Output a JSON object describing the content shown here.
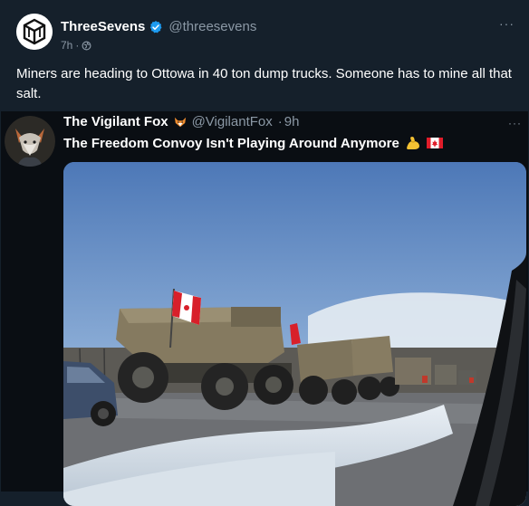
{
  "tweet": {
    "display_name": "ThreeSevens",
    "handle": "@threesevens",
    "time": "7h",
    "text": "Miners are heading to Ottowa in 40 ton dump trucks. Someone has to mine all that salt.",
    "more_label": "···"
  },
  "quote": {
    "display_name": "The Vigilant Fox",
    "handle": "@VigilantFox",
    "time": "9h",
    "text": "The Freedom Convoy Isn't Playing Around Anymore",
    "more_label": "···"
  },
  "colors": {
    "background": "#15202b",
    "verified_blue": "#1d9bf0",
    "secondary_text": "#8b98a5"
  },
  "icons": {
    "verified": "verified-badge-icon",
    "fox_emoji": "fox-emoji-icon",
    "flexed_biceps": "flexed-biceps-emoji-icon",
    "canada_flag": "canada-flag-emoji-icon",
    "audience": "globe-audience-icon"
  }
}
